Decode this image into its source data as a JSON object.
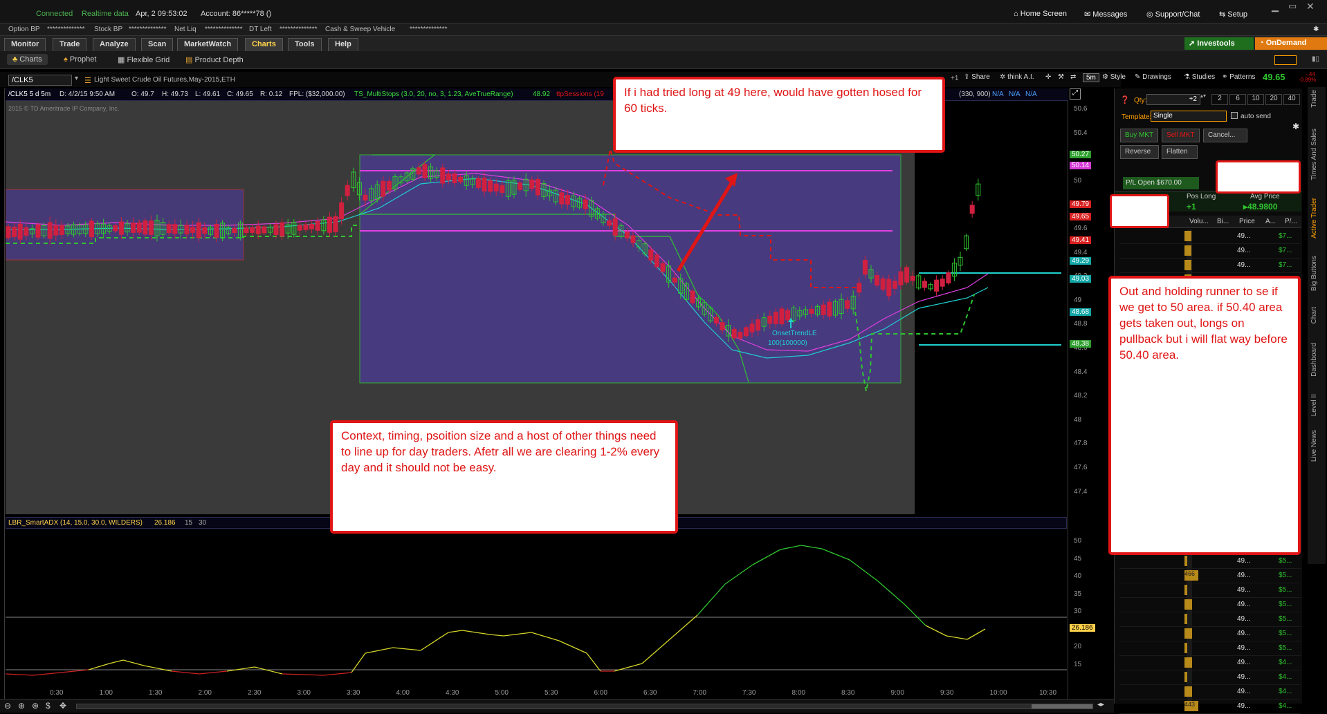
{
  "status": {
    "connected": "Connected",
    "realtime": "Realtime data",
    "datetime": "Apr, 2  09:53:02",
    "account": "Account: 86*****78 ()",
    "home": "Home Screen",
    "messages": "Messages",
    "support": "Support/Chat",
    "setup": "Setup"
  },
  "account_bar": {
    "option_bp": "Option BP",
    "stock_bp": "Stock BP",
    "net_liq": "Net Liq",
    "dt_left": "DT Left",
    "cash_sweep": "Cash & Sweep Vehicle",
    "masked": "**************",
    "investools": "Investools",
    "ondemand": "OnDemand"
  },
  "menu": {
    "tabs": [
      "Monitor",
      "Trade",
      "Analyze",
      "Scan",
      "MarketWatch",
      "Charts",
      "Tools",
      "Help"
    ],
    "active": "Charts"
  },
  "subtabs": [
    "Charts",
    "Prophet",
    "Flexible Grid",
    "Product Depth"
  ],
  "chart_header": {
    "symbol": "/CLK5",
    "description": "Light Sweet Crude Oil Futures,May-2015,ETH",
    "share": "Share",
    "thinkai": "think A.I.",
    "timeframe": "5m",
    "style": "Style",
    "drawings": "Drawings",
    "studies": "Studies",
    "patterns": "Patterns",
    "last": "49.65",
    "change": "-.44",
    "change_pct": "-0.89%"
  },
  "info_bar": {
    "symbol": "/CLK5 5 d 5m",
    "date": "D: 4/2/15 9:50 AM",
    "open": "O: 49.7",
    "high": "H: 49.73",
    "low": "L: 49.61",
    "close": "C: 49.65",
    "range": "R: 0.12",
    "fpl": "FPL: ($32,000.00)",
    "study": "TS_MultiStops (3.0, 20, no, 3, 1.23, AveTrueRange)",
    "study_val": "48.92",
    "sessions": "ttpSessions (19",
    "study2": "(330, 900)",
    "na1": "N/A",
    "na2": "N/A",
    "na3": "N/A",
    "copyright": "2015 © TD Ameritrade IP Company, Inc."
  },
  "price_axis": [
    "50.6",
    "50.4",
    "50.2",
    "50",
    "49.8",
    "49.6",
    "49.4",
    "49.2",
    "49",
    "48.8",
    "48.6",
    "48.4",
    "48.2",
    "48",
    "47.8",
    "47.6",
    "47.4"
  ],
  "price_tags": [
    {
      "label": "50.27",
      "color": "#2ea02e"
    },
    {
      "label": "50.14",
      "color": "#d63ad6"
    },
    {
      "label": "49.79",
      "color": "#d82020"
    },
    {
      "label": "49.65",
      "color": "#d82020"
    },
    {
      "label": "49.41",
      "color": "#d82020"
    },
    {
      "label": "49.29",
      "color": "#14a7a7"
    },
    {
      "label": "49.03",
      "color": "#14a7a7"
    },
    {
      "label": "48.68",
      "color": "#14a7a7"
    },
    {
      "label": "48.38",
      "color": "#2ea02e"
    }
  ],
  "chart_annotation": {
    "onset": "OnsetTrendLE",
    "onset_size": "100(100000)"
  },
  "adx": {
    "label": "LBR_SmartADX (14, 15.0, 30.0, WILDERS)",
    "value": "26.186",
    "p1": "15",
    "p2": "30",
    "axis": [
      "50",
      "45",
      "40",
      "35",
      "30",
      "25",
      "20",
      "15"
    ]
  },
  "time_axis": [
    "0:30",
    "1:00",
    "1:30",
    "2:00",
    "2:30",
    "3:00",
    "3:30",
    "4:00",
    "4:30",
    "5:00",
    "5:30",
    "6:00",
    "6:30",
    "7:00",
    "7:30",
    "8:00",
    "8:30",
    "9:00",
    "9:30",
    "10:00",
    "10:30"
  ],
  "active_trader": {
    "qty_label": "Qty:",
    "qty": "+2",
    "qty_presets": [
      "2",
      "6",
      "10",
      "20",
      "40"
    ],
    "template_label": "Template:",
    "template": "Single",
    "auto_send": "auto send",
    "buy_mkt": "Buy MKT",
    "sell_mkt": "Sell MKT",
    "cancel": "Cancel...",
    "reverse": "Reverse",
    "flatten": "Flatten",
    "pl_open": "P/L Open $670.00",
    "pos_long_label": "Pos Long",
    "pos_long": "+1",
    "avg_price_label": "Avg Price",
    "avg_price": "48.9800",
    "columns": [
      "Volu...",
      "Bi...",
      "Price",
      "A...",
      "P/..."
    ],
    "ladder_price": "49...",
    "ladder_rows_top": [
      "$7...",
      "$7...",
      "$7...",
      "$7..."
    ],
    "ladder_rows_bottom": [
      {
        "vol": "",
        "pl": "$5..."
      },
      {
        "vol": "466",
        "pl": "$5..."
      },
      {
        "vol": "",
        "pl": "$5..."
      },
      {
        "vol": "",
        "pl": "$5..."
      },
      {
        "vol": "",
        "pl": "$5..."
      },
      {
        "vol": "",
        "pl": "$5..."
      },
      {
        "vol": "",
        "pl": "$5..."
      },
      {
        "vol": "",
        "pl": "$4..."
      },
      {
        "vol": "",
        "pl": "$4..."
      },
      {
        "vol": "",
        "pl": "$4..."
      },
      {
        "vol": "443",
        "pl": "$4..."
      }
    ]
  },
  "side_tabs": [
    "Trade",
    "Times And Sales",
    "Active Trader",
    "Big Buttons",
    "Chart",
    "Dashboard",
    "Level II",
    "Live News"
  ],
  "callouts": {
    "top": "If i had tried long at 49 here, would have gotten hosed for 60 ticks.",
    "middle": "Context, timing, psoition size and a host of other things need to line up for day traders. Afetr all we are clearing 1-2% every day and it should not be easy.",
    "right": "Out and holding runner to se if we get to 50 area. if 50.40 area gets taken out, longs on pullback but i will flat way before 50.40 area."
  },
  "colors": {
    "accent_orange": "#ffa000",
    "green": "#2fc62f",
    "red": "#e01515",
    "magenta": "#e040e0",
    "cyan": "#20d0d0"
  }
}
